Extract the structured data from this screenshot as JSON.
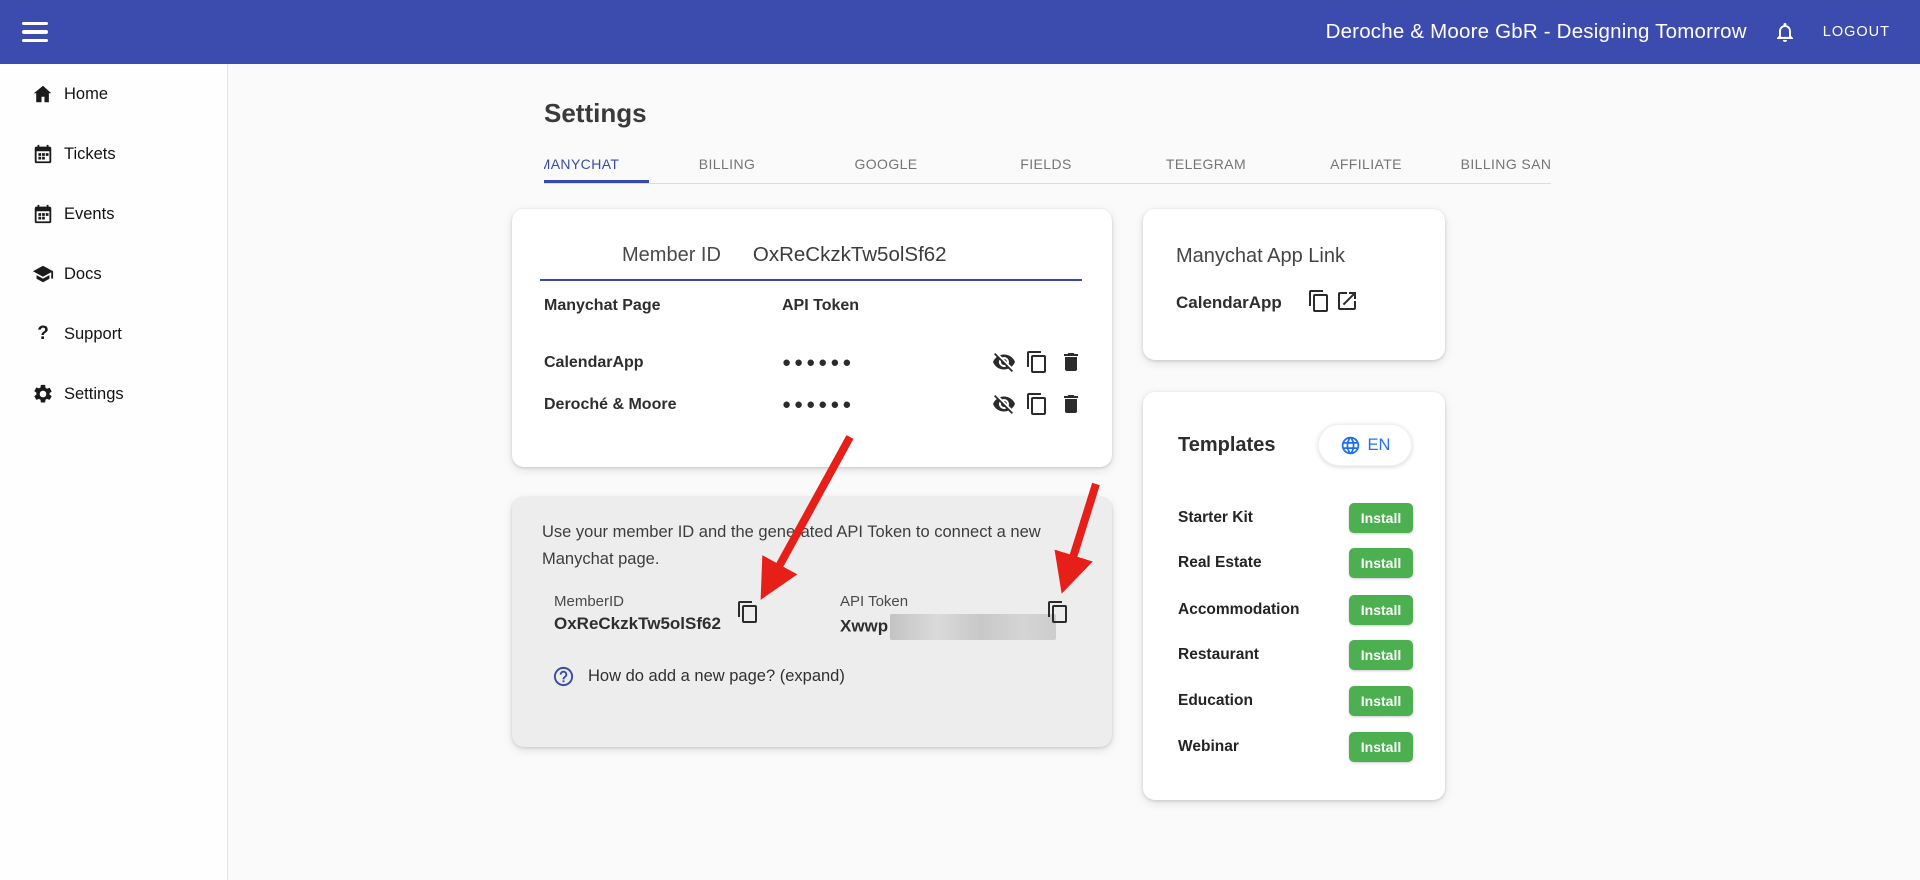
{
  "header": {
    "title": "Deroche & Moore GbR - Designing Tomorrow",
    "logout_label": "LOGOUT"
  },
  "sidebar": {
    "items": [
      {
        "label": "Home",
        "icon": "home-icon"
      },
      {
        "label": "Tickets",
        "icon": "calendar-icon"
      },
      {
        "label": "Events",
        "icon": "calendar-icon"
      },
      {
        "label": "Docs",
        "icon": "graduate-icon"
      },
      {
        "label": "Support",
        "icon": "question-icon"
      },
      {
        "label": "Settings",
        "icon": "gear-icon"
      }
    ]
  },
  "page": {
    "title": "Settings"
  },
  "tabs": {
    "items": [
      {
        "label": "MANYCHAT",
        "active": true
      },
      {
        "label": "BILLING",
        "active": false
      },
      {
        "label": "GOOGLE",
        "active": false
      },
      {
        "label": "FIELDS",
        "active": false
      },
      {
        "label": "TELEGRAM",
        "active": false
      },
      {
        "label": "AFFILIATE",
        "active": false
      },
      {
        "label": "BILLING SAN",
        "active": false
      }
    ]
  },
  "member_card": {
    "member_id_label": "Member ID",
    "member_id_value": "OxReCkzkTw5olSf62",
    "col_page": "Manychat Page",
    "col_token": "API Token",
    "rows": [
      {
        "page": "CalendarApp",
        "token_masked": "●●●●●●"
      },
      {
        "page": "Deroché & Moore",
        "token_masked": "●●●●●●"
      }
    ]
  },
  "connect_card": {
    "description": "Use your member ID and the generated API Token to connect a new Manychat page.",
    "member_id_label": "MemberID",
    "member_id_value": "OxReCkzkTw5olSf62",
    "api_token_label": "API Token",
    "api_token_value_visible": "Xwwp",
    "help_text": "How do add a new page? (expand)"
  },
  "app_link_card": {
    "title": "Manychat App Link",
    "app_name": "CalendarApp"
  },
  "templates_card": {
    "title": "Templates",
    "language": "EN",
    "install_label": "Install",
    "items": [
      "Starter Kit",
      "Real Estate",
      "Accommodation",
      "Restaurant",
      "Education",
      "Webinar"
    ]
  },
  "colors": {
    "header_bg": "#3c4cae",
    "accent_indigo": "#3949ab",
    "install_green": "#4caf50",
    "arrow_red": "#e71f19",
    "link_blue": "#2470f2"
  }
}
